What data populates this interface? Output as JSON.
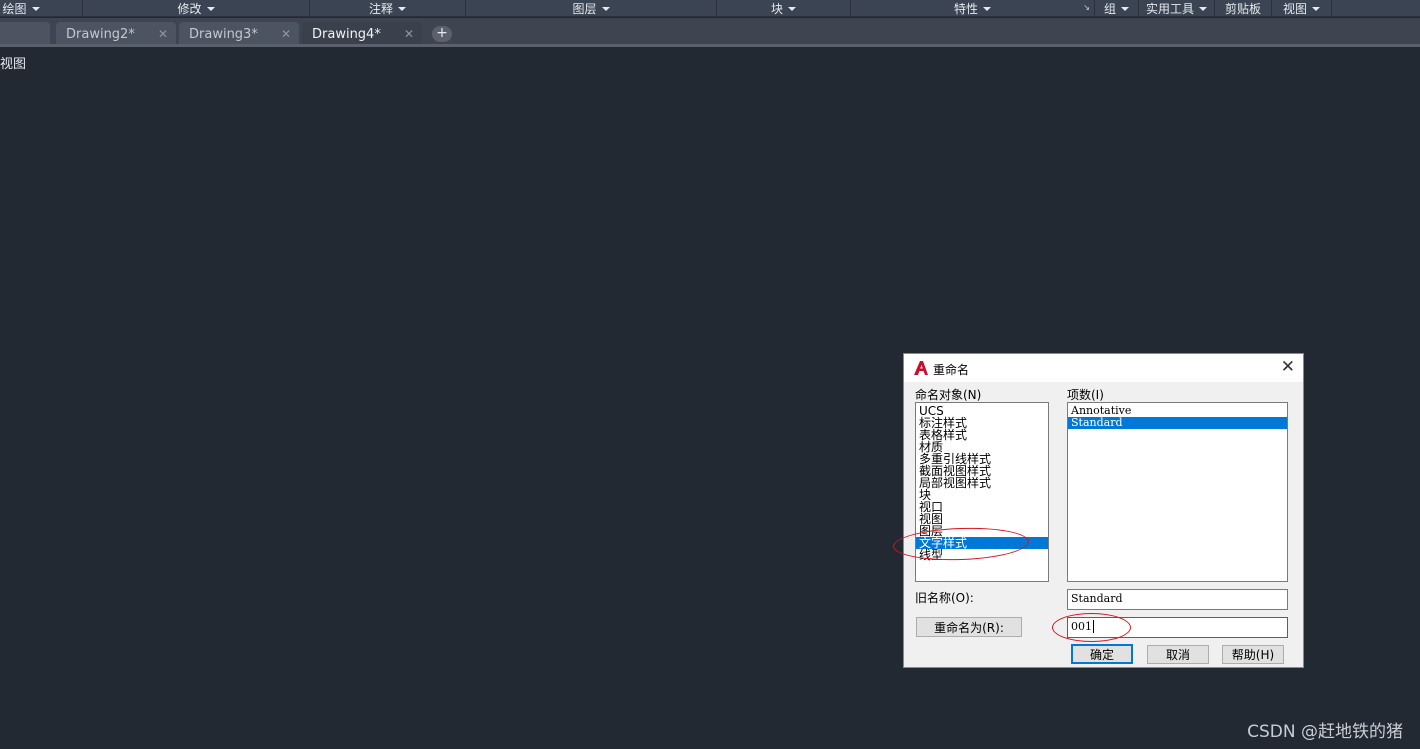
{
  "ribbon": {
    "panels": [
      {
        "label": "绘图",
        "caret": true
      },
      {
        "label": "修改",
        "caret": true
      },
      {
        "label": "注释",
        "caret": true
      },
      {
        "label": "图层",
        "caret": true
      },
      {
        "label": "块",
        "caret": true
      },
      {
        "label": "特性",
        "caret": true
      },
      {
        "label": "组",
        "caret": true
      },
      {
        "label": "实用工具",
        "caret": true
      },
      {
        "label": "剪贴板",
        "caret": false
      },
      {
        "label": "视图",
        "caret": true
      }
    ]
  },
  "tabs": [
    {
      "label": "Drawing2*",
      "active": false
    },
    {
      "label": "Drawing3*",
      "active": false
    },
    {
      "label": "Drawing4*",
      "active": true
    }
  ],
  "viewport": {
    "label": "视图"
  },
  "dialog": {
    "title": "重命名",
    "close_glyph": "✕",
    "named_objects_label": "命名对象(N)",
    "items_label": "项数(I)",
    "named_objects": [
      "UCS",
      "标注样式",
      "表格样式",
      "材质",
      "多重引线样式",
      "截面视图样式",
      "局部视图样式",
      "块",
      "视口",
      "视图",
      "图层",
      "文字样式",
      "线型"
    ],
    "named_objects_selected": "文字样式",
    "items": [
      "Annotative",
      "Standard"
    ],
    "items_selected": "Standard",
    "old_name_label": "旧名称(O):",
    "old_name_value": "Standard",
    "rename_to_button": "重命名为(R):",
    "new_name_value": "001",
    "ok_button": "确定",
    "cancel_button": "取消",
    "help_button": "帮助(H)"
  },
  "colors": {
    "selection": "#0078d7",
    "annotation": "#d9141a",
    "canvas": "#222933"
  },
  "watermark": "CSDN @赶地铁的猪"
}
